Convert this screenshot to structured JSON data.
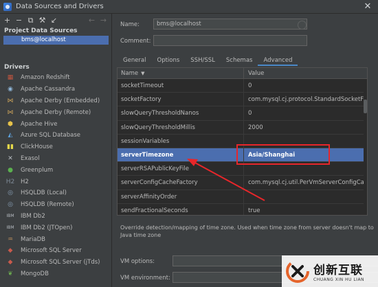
{
  "window": {
    "title": "Data Sources and Drivers",
    "close_glyph": "✕"
  },
  "toolbar": {
    "icons": [
      "add-icon",
      "remove-icon",
      "duplicate-icon",
      "wrench-icon",
      "import-icon",
      "back-icon",
      "forward-icon"
    ]
  },
  "project": {
    "section_title": "Project Data Sources",
    "items": [
      "bms@localhost"
    ]
  },
  "drivers": {
    "section_title": "Drivers",
    "items": [
      {
        "label": "Amazon Redshift",
        "icon": "redshift-icon",
        "glyph": "▦",
        "color": "#c0553f"
      },
      {
        "label": "Apache Cassandra",
        "icon": "cassandra-icon",
        "glyph": "◉",
        "color": "#8fb6d8"
      },
      {
        "label": "Apache Derby (Embedded)",
        "icon": "derby-icon",
        "glyph": "⋈",
        "color": "#c9a15a"
      },
      {
        "label": "Apache Derby (Remote)",
        "icon": "derby-icon",
        "glyph": "⋈",
        "color": "#c9a15a"
      },
      {
        "label": "Apache Hive",
        "icon": "hive-icon",
        "glyph": "⬢",
        "color": "#e6c24a"
      },
      {
        "label": "Azure SQL Database",
        "icon": "azure-icon",
        "glyph": "◭",
        "color": "#5c9ed6"
      },
      {
        "label": "ClickHouse",
        "icon": "clickhouse-icon",
        "glyph": "▮▮",
        "color": "#e3d74a"
      },
      {
        "label": "Exasol",
        "icon": "exasol-icon",
        "glyph": "✕",
        "color": "#b7bcc2"
      },
      {
        "label": "Greenplum",
        "icon": "greenplum-icon",
        "glyph": "●",
        "color": "#5bb04f"
      },
      {
        "label": "H2",
        "icon": "h2-icon",
        "glyph": "H2",
        "color": "#7e8a96"
      },
      {
        "label": "HSQLDB (Local)",
        "icon": "hsqldb-icon",
        "glyph": "◎",
        "color": "#8aa1b8"
      },
      {
        "label": "HSQLDB (Remote)",
        "icon": "hsqldb-icon",
        "glyph": "◎",
        "color": "#8aa1b8"
      },
      {
        "label": "IBM Db2",
        "icon": "db2-icon",
        "glyph": "IBM",
        "color": "#b7bcc2"
      },
      {
        "label": "IBM Db2 (JTOpen)",
        "icon": "db2-icon",
        "glyph": "IBM",
        "color": "#b7bcc2"
      },
      {
        "label": "MariaDB",
        "icon": "mariadb-icon",
        "glyph": "♒",
        "color": "#b58b5c"
      },
      {
        "label": "Microsoft SQL Server",
        "icon": "mssql-icon",
        "glyph": "◆",
        "color": "#c85a4c"
      },
      {
        "label": "Microsoft SQL Server (jTds)",
        "icon": "mssql-icon",
        "glyph": "◆",
        "color": "#c85a4c"
      },
      {
        "label": "MongoDB",
        "icon": "mongodb-icon",
        "glyph": "❦",
        "color": "#6aa84f"
      }
    ]
  },
  "form": {
    "name_label": "Name:",
    "name_value": "bms@localhost",
    "comment_label": "Comment:",
    "comment_value": ""
  },
  "tabs": [
    {
      "label": "General",
      "active": false
    },
    {
      "label": "Options",
      "active": false
    },
    {
      "label": "SSH/SSL",
      "active": false
    },
    {
      "label": "Schemas",
      "active": false
    },
    {
      "label": "Advanced",
      "active": true
    }
  ],
  "grid": {
    "header_name": "Name",
    "header_value": "Value",
    "sort_glyph": "▼",
    "rows": [
      {
        "name": "socketTimeout",
        "value": "0",
        "selected": false
      },
      {
        "name": "socketFactory",
        "value": "com.mysql.cj.protocol.StandardSocketFactory",
        "selected": false
      },
      {
        "name": "slowQueryThresholdNanos",
        "value": "0",
        "selected": false
      },
      {
        "name": "slowQueryThresholdMillis",
        "value": "2000",
        "selected": false
      },
      {
        "name": "sessionVariables",
        "value": "",
        "selected": false
      },
      {
        "name": "serverTimezone",
        "value": "Asia/Shanghai",
        "selected": true
      },
      {
        "name": "serverRSAPublicKeyFile",
        "value": "",
        "selected": false
      },
      {
        "name": "serverConfigCacheFactory",
        "value": "com.mysql.cj.util.PerVmServerConfigCacheFa",
        "selected": false
      },
      {
        "name": "serverAffinityOrder",
        "value": "",
        "selected": false
      },
      {
        "name": "sendFractionalSeconds",
        "value": "true",
        "selected": false
      }
    ]
  },
  "description": "Override detection/mapping of time zone. Used when time zone from server doesn't map to Java time zone",
  "vm": {
    "options_label": "VM options:",
    "environment_label": "VM environment:"
  },
  "annotation": {
    "box_color": "#e8262a"
  },
  "watermark": {
    "cn": "创新互联",
    "en": "CHUANG XIN HU LIAN"
  }
}
